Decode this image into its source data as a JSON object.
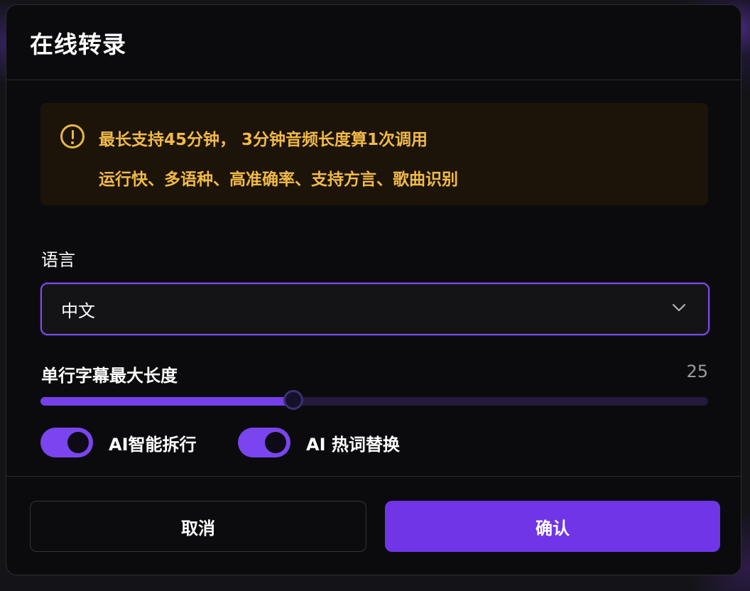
{
  "dialog": {
    "title": "在线转录"
  },
  "notice": {
    "icon": "alert-circle-icon",
    "color": "#f0b949",
    "line1": "最长支持45分钟， 3分钟音频长度算1次调用",
    "line2": "运行快、多语种、高准确率、支持方言、歌曲识别"
  },
  "language": {
    "label": "语言",
    "selected": "中文",
    "icon": "chevron-down-icon"
  },
  "max_length": {
    "label": "单行字幕最大长度",
    "value": "25",
    "fraction": 0.379
  },
  "toggles": [
    {
      "label": "AI智能拆行",
      "on": true
    },
    {
      "label": "AI 热词替换",
      "on": true
    }
  ],
  "buttons": {
    "cancel": "取消",
    "confirm": "确认"
  },
  "colors": {
    "accent": "#6f35e6",
    "warning": "#f0b949"
  }
}
